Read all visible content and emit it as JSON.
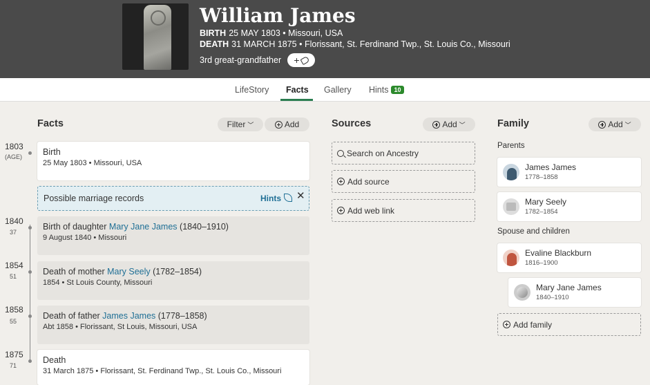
{
  "header": {
    "name": "William James",
    "birth_label": "BIRTH",
    "birth_value": "25 MAY 1803 • Missouri, USA",
    "death_label": "DEATH",
    "death_value": "31 MARCH 1875 • Florissant, St. Ferdinand Twp., St. Louis Co., Missouri",
    "relationship": "3rd great-grandfather",
    "tag_button_label": "+"
  },
  "tabs": [
    {
      "label": "LifeStory"
    },
    {
      "label": "Facts",
      "active": true
    },
    {
      "label": "Gallery"
    },
    {
      "label": "Hints",
      "badge": "10"
    }
  ],
  "facts": {
    "title": "Facts",
    "filter_label": "Filter",
    "add_label": "Add",
    "timeline": [
      {
        "year": "1803",
        "age": "(AGE)"
      },
      {
        "year": "1840",
        "age": "37"
      },
      {
        "year": "1854",
        "age": "51"
      },
      {
        "year": "1858",
        "age": "55"
      },
      {
        "year": "1875",
        "age": "71"
      }
    ],
    "hint": {
      "text": "Possible marriage records",
      "link": "Hints",
      "close": "✕"
    },
    "items": [
      {
        "title": "Birth",
        "subtitle": "25 May 1803 • Missouri, USA"
      },
      {
        "title_prefix": "Birth of daughter ",
        "link": "Mary Jane James",
        "title_suffix": " (1840–1910)",
        "subtitle": "9 August 1840 • Missouri"
      },
      {
        "title_prefix": "Death of mother ",
        "link": "Mary Seely",
        "title_suffix": " (1782–1854)",
        "subtitle": "1854 • St Louis County, Missouri"
      },
      {
        "title_prefix": "Death of father ",
        "link": "James James",
        "title_suffix": " (1778–1858)",
        "subtitle": "Abt 1858 • Florissant, St Louis, Missouri, USA"
      },
      {
        "title": "Death",
        "subtitle": "31 March 1875 • Florissant, St. Ferdinand Twp., St. Louis Co., Missouri"
      }
    ]
  },
  "sources": {
    "title": "Sources",
    "add_label": "Add",
    "search_label": "Search on Ancestry",
    "add_source_label": "Add source",
    "add_web_link_label": "Add web link"
  },
  "family": {
    "title": "Family",
    "add_label": "Add",
    "parents_label": "Parents",
    "spouse_label": "Spouse and children",
    "parents": [
      {
        "name": "James James",
        "dates": "1778–1858"
      },
      {
        "name": "Mary Seely",
        "dates": "1782–1854"
      }
    ],
    "spouse": {
      "name": "Evaline Blackburn",
      "dates": "1816–1900"
    },
    "children": [
      {
        "name": "Mary Jane James",
        "dates": "1840–1910"
      }
    ],
    "add_family_label": "Add family"
  }
}
